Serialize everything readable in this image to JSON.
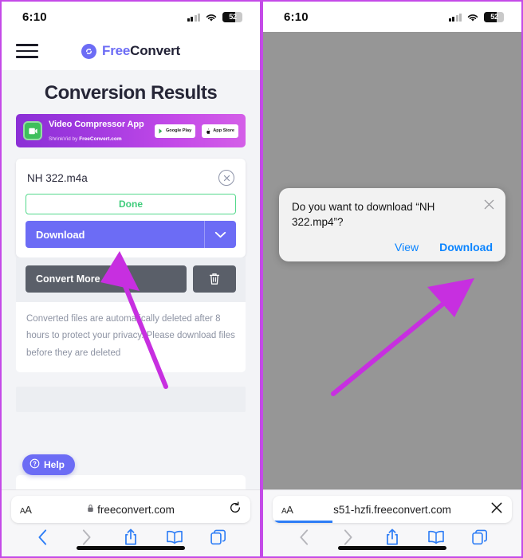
{
  "left": {
    "status": {
      "time": "6:10",
      "battery_percent": "52",
      "wifi_icon": "wifi-icon",
      "signal_icon": "cellular-signal-icon"
    },
    "header": {
      "menu_icon": "hamburger-menu-icon",
      "brand_first": "Free",
      "brand_second": "Convert",
      "logo_icon": "freeconvert-logo-icon"
    },
    "page_title": "Conversion Results",
    "promo": {
      "icon": "video-app-icon",
      "title": "Video Compressor App",
      "subtitle_prefix": "ShrinkVid by ",
      "subtitle_brand": "FreeConvert.com",
      "google_play": "Google Play",
      "app_store": "App Store",
      "gradient_from": "#8b2fd6",
      "gradient_to": "#d45fe8"
    },
    "card": {
      "file_name": "NH 322.m4a",
      "close_icon": "close-circle-icon",
      "status_label": "Done",
      "status_color": "#3fcc7b",
      "download_label": "Download",
      "download_color": "#6c6cf5",
      "dropdown_icon": "chevron-down-icon"
    },
    "actions": {
      "convert_more_label": "Convert More",
      "external_link_icon": "external-link-icon",
      "delete_icon": "trash-icon",
      "button_color": "#5a5f69"
    },
    "notice": "Converted files are automatically deleted after 8 hours to protect your privacy. Please download files before they are deleted",
    "help": {
      "label": "Help",
      "icon": "question-circle-icon",
      "color": "#6c6cf5"
    },
    "safari": {
      "text_size_label": "AA",
      "lock_icon": "lock-icon",
      "url": "freeconvert.com",
      "reload_icon": "reload-icon",
      "back_icon": "chevron-left-icon",
      "forward_icon": "chevron-right-icon",
      "share_icon": "share-icon",
      "bookmarks_icon": "book-icon",
      "tabs_icon": "tabs-icon",
      "show_progress": false
    }
  },
  "right": {
    "status": {
      "time": "6:10",
      "battery_percent": "52",
      "wifi_icon": "wifi-icon",
      "signal_icon": "cellular-signal-icon"
    },
    "dialog": {
      "message": "Do you want to download “NH 322.mp4”?",
      "close_icon": "close-x-icon",
      "view_label": "View",
      "download_label": "Download",
      "link_color": "#0a84ff"
    },
    "safari": {
      "text_size_label": "AA",
      "url": "s51-hzfi.freeconvert.com",
      "stop_icon": "close-x-icon",
      "back_icon": "chevron-left-icon",
      "forward_icon": "chevron-right-icon",
      "share_icon": "share-icon",
      "bookmarks_icon": "book-icon",
      "tabs_icon": "tabs-icon",
      "show_progress": true,
      "progress_color": "#2d7df6"
    }
  },
  "annotations": {
    "arrow_color": "#c72fe0",
    "left_arrow_target": "Download",
    "right_arrow_target": "Download"
  }
}
